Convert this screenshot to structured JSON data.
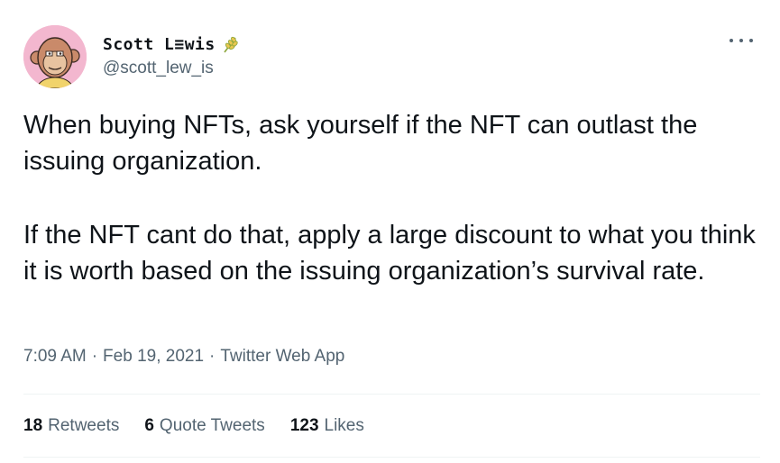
{
  "author": {
    "display_name": "Scott L≡wis",
    "handle": "@scott_lew_is",
    "avatar_icon": "ape-avatar-icon",
    "badge_icon": "wheat-icon"
  },
  "tweet": {
    "paragraph_1": "When buying NFTs, ask yourself if the NFT can outlast the issuing organization.",
    "paragraph_2": "If the NFT cant do that,  apply a large discount to what you think it is worth based on the issuing organization’s survival rate."
  },
  "meta": {
    "time": "7:09 AM",
    "separator": "·",
    "date": "Feb 19, 2021",
    "source": "Twitter Web App"
  },
  "stats": {
    "retweets_count": "18",
    "retweets_label": "Retweets",
    "quotes_count": "6",
    "quotes_label": "Quote Tweets",
    "likes_count": "123",
    "likes_label": "Likes"
  },
  "colors": {
    "text": "#0f1419",
    "secondary": "#536471",
    "divider": "#eff3f4",
    "avatar_bg": "#f3b7cf"
  }
}
